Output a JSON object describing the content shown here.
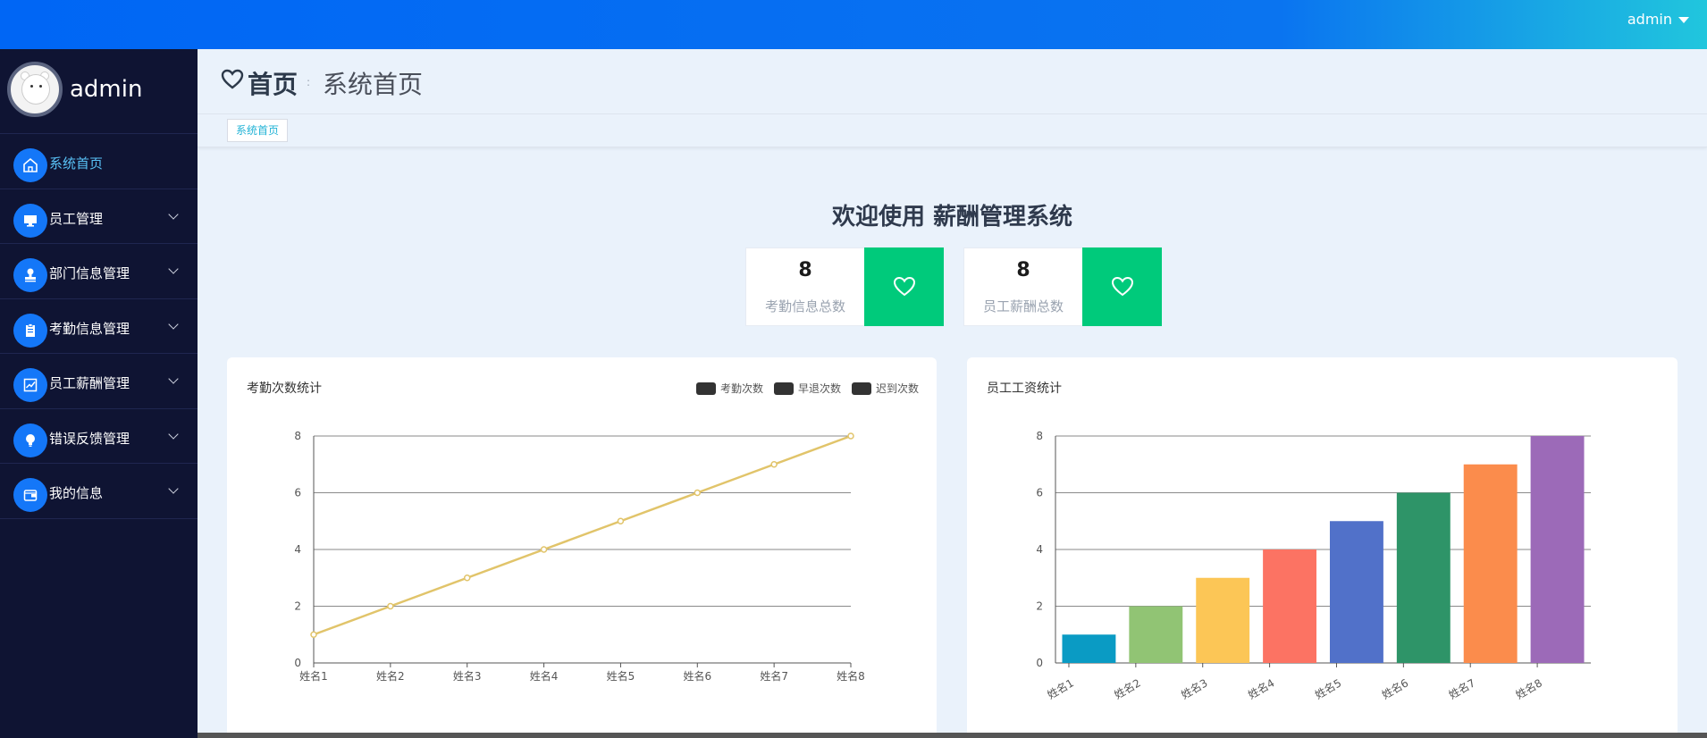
{
  "topbar": {
    "user_label": "admin"
  },
  "sidebar": {
    "profile_name": "admin",
    "items": [
      {
        "label": "系统首页",
        "icon": "home-icon",
        "active": true
      },
      {
        "label": "员工管理",
        "icon": "monitor-icon"
      },
      {
        "label": "部门信息管理",
        "icon": "stamp-icon"
      },
      {
        "label": "考勤信息管理",
        "icon": "clipboard-icon"
      },
      {
        "label": "员工薪酬管理",
        "icon": "chart-icon"
      },
      {
        "label": "错误反馈管理",
        "icon": "bulb-icon"
      },
      {
        "label": "我的信息",
        "icon": "wallet-icon"
      }
    ]
  },
  "header": {
    "title": "首页",
    "separator": ":",
    "subtitle": "系统首页"
  },
  "tags": [
    "系统首页"
  ],
  "welcome": "欢迎使用 薪酬管理系统",
  "stats": [
    {
      "value": "8",
      "label": "考勤信息总数"
    },
    {
      "value": "8",
      "label": "员工薪酬总数"
    }
  ],
  "colors": {
    "accent": "#1477f8",
    "stat_button": "#00ca7b",
    "sidebar_bg": "#0f1433",
    "line": "#e1c46a"
  },
  "chart_data": [
    {
      "type": "line",
      "title": "考勤次数统计",
      "legend": [
        "考勤次数",
        "早退次数",
        "迟到次数"
      ],
      "legend_placement": "top-right",
      "categories": [
        "姓名1",
        "姓名2",
        "姓名3",
        "姓名4",
        "姓名5",
        "姓名6",
        "姓名7",
        "姓名8"
      ],
      "series": [
        {
          "name": "考勤次数",
          "values": [
            1,
            2,
            3,
            4,
            5,
            6,
            7,
            8
          ]
        }
      ],
      "ylim": [
        0,
        8
      ],
      "yticks": [
        0,
        2,
        4,
        6,
        8
      ],
      "grid": true
    },
    {
      "type": "bar",
      "title": "员工工资统计",
      "categories": [
        "姓名1",
        "姓名2",
        "姓名3",
        "姓名4",
        "姓名5",
        "姓名6",
        "姓名7",
        "姓名8"
      ],
      "values": [
        1,
        2,
        3,
        4,
        5,
        6,
        7,
        8
      ],
      "bar_colors": [
        "#0a9bc4",
        "#91c474",
        "#fcc656",
        "#fc7363",
        "#5171c9",
        "#2e9468",
        "#fb8c4c",
        "#9c6ab8"
      ],
      "ylim": [
        0,
        8
      ],
      "yticks": [
        0,
        2,
        4,
        6,
        8
      ],
      "grid": true
    }
  ]
}
